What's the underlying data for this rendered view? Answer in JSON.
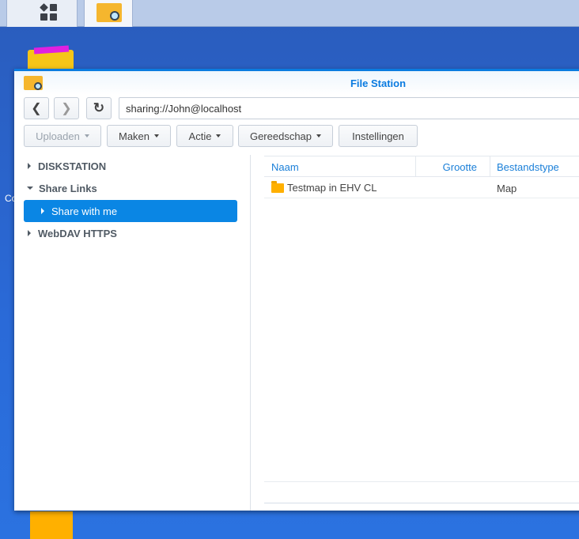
{
  "taskbar": {
    "items": [
      {
        "icon": "main-menu-grid-icon"
      },
      {
        "icon": "file-station-icon"
      }
    ]
  },
  "desktop": {
    "partial_label": "Co"
  },
  "window": {
    "title": "File Station",
    "accent": "#0a7be0"
  },
  "nav": {
    "back": "chevron-left-icon",
    "forward": "chevron-right-icon",
    "refresh": "refresh-icon",
    "address": "sharing://John@localhost"
  },
  "toolbar": {
    "upload": "Uploaden",
    "create": "Maken",
    "action": "Actie",
    "tools": "Gereedschap",
    "settings": "Instellingen"
  },
  "sidebar": {
    "items": [
      {
        "label": "DISKSTATION",
        "expanded": false
      },
      {
        "label": "Share Links",
        "expanded": true
      },
      {
        "label": "Share with me",
        "selected": true
      },
      {
        "label": "WebDAV HTTPS",
        "expanded": false
      }
    ]
  },
  "list": {
    "columns": [
      "Naam",
      "Grootte",
      "Bestandstype"
    ],
    "rows": [
      {
        "name": "Testmap in EHV CL",
        "size": "",
        "type": "Map"
      }
    ]
  }
}
